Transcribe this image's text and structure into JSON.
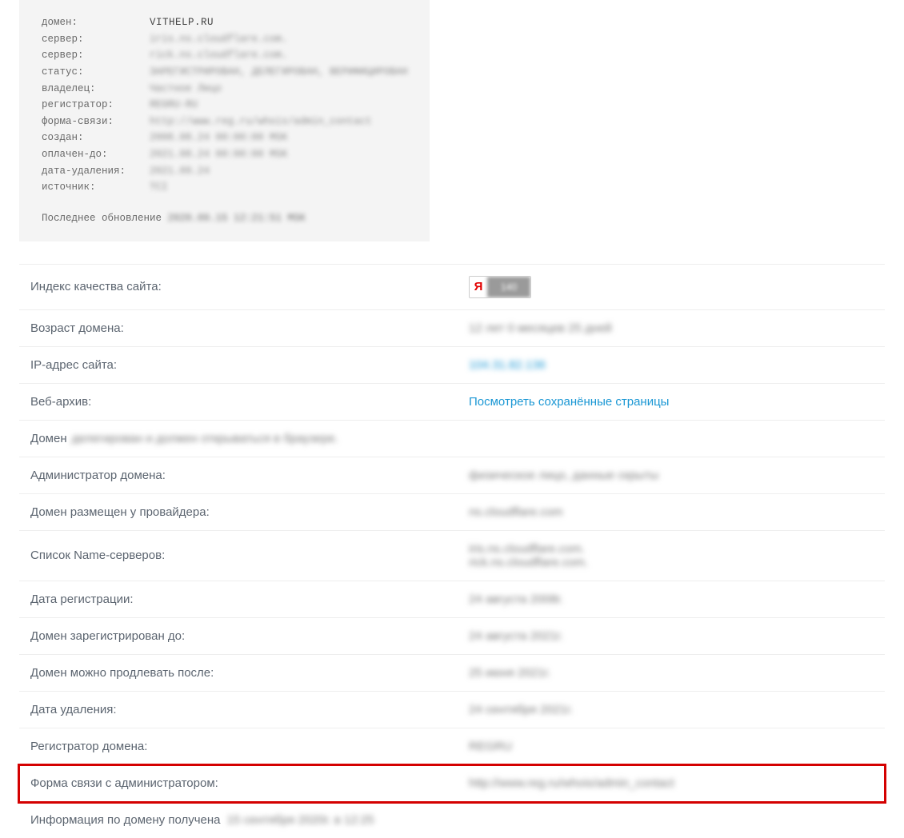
{
  "whois": {
    "rows": [
      {
        "label": "домен:",
        "value": "VITHELP.RU",
        "blur": false,
        "pad": 18
      },
      {
        "label": "сервер:",
        "value": "iris.ns.cloudflare.com.",
        "blur": true,
        "pad": 18
      },
      {
        "label": "сервер:",
        "value": "rick.ns.cloudflare.com.",
        "blur": true,
        "pad": 18
      },
      {
        "label": "статус:",
        "value": "ЗАРЕГИСТРИРОВАН, ДЕЛЕГИРОВАН, ВЕРИФИЦИРОВАН",
        "blur": true,
        "pad": 18
      },
      {
        "label": "владелец:",
        "value": "Частное Лицо",
        "blur": true,
        "pad": 18
      },
      {
        "label": "регистратор:",
        "value": "REGRU-RU",
        "blur": true,
        "pad": 18
      },
      {
        "label": "форма-связи:",
        "value": "http://www.reg.ru/whois/admin_contact",
        "blur": true,
        "pad": 18
      },
      {
        "label": "создан:",
        "value": "2008.08.24 00:00:00 MSK",
        "blur": true,
        "pad": 18
      },
      {
        "label": "оплачен-до:",
        "value": "2021.08.24 00:00:00 MSK",
        "blur": true,
        "pad": 18
      },
      {
        "label": "дата-удаления:",
        "value": "2021.09.24",
        "blur": true,
        "pad": 18
      },
      {
        "label": "источник:",
        "value": "TCI",
        "blur": true,
        "pad": 18
      }
    ],
    "update_label": "Последнее обновление",
    "update_value": "2020.09.15 12:21:51 MSK"
  },
  "info": {
    "quality_label": "Индекс качества сайта:",
    "quality_badge_letter": "Я",
    "quality_badge_value": "140",
    "age_label": "Возраст домена:",
    "age_value": "12 лет 0 месяцев 25 дней",
    "ip_label": "IP-адрес сайта:",
    "ip_value": "104.31.82.136",
    "archive_label": "Веб-архив:",
    "archive_value": "Посмотреть сохранённые страницы",
    "domain_status_label": "Домен",
    "domain_status_value": "делегирован и должен открываться в браузере.",
    "admin_label": "Администратор домена:",
    "admin_value": "физическое лицо, данные скрыты",
    "provider_label": "Домен размещен у провайдера:",
    "provider_value": "ns.cloudflare.com",
    "ns_label": "Список Name-серверов:",
    "ns_value1": "iris.ns.cloudflare.com.",
    "ns_value2": "rick.ns.cloudflare.com.",
    "reg_date_label": "Дата регистрации:",
    "reg_date_value": "24 августа 2008г.",
    "reg_until_label": "Домен зарегистрирован до:",
    "reg_until_value": "24 августа 2021г.",
    "renew_after_label": "Домен можно продлевать после:",
    "renew_after_value": "25 июня 2021г.",
    "del_date_label": "Дата удаления:",
    "del_date_value": "24 сентября 2021г.",
    "registrar_label": "Регистратор домена:",
    "registrar_value": "REGRU",
    "contact_form_label": "Форма связи с администратором:",
    "contact_form_value": "http://www.reg.ru/whois/admin_contact",
    "retrieved_label": "Информация по домену получена",
    "retrieved_value": "15 сентября 2020г. в 12:25"
  }
}
